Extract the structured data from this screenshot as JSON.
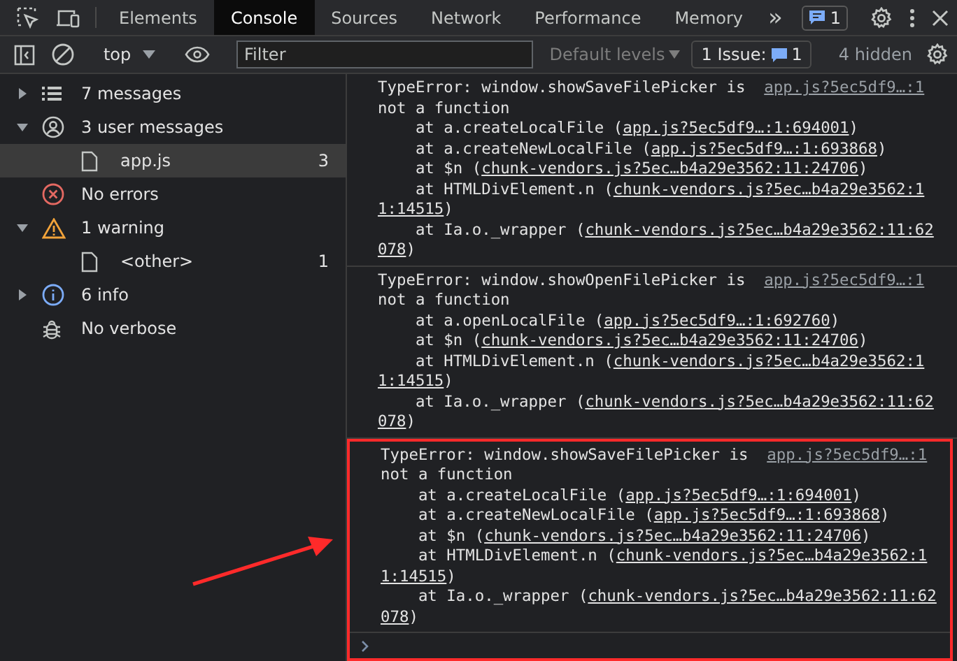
{
  "main_tabs": [
    {
      "label": "Elements",
      "selected": false
    },
    {
      "label": "Console",
      "selected": true
    },
    {
      "label": "Sources",
      "selected": false
    },
    {
      "label": "Network",
      "selected": false
    },
    {
      "label": "Performance",
      "selected": false
    },
    {
      "label": "Memory",
      "selected": false
    }
  ],
  "more_tabs": "»",
  "messages_badge": "1",
  "toolbar": {
    "context": "top",
    "filter": {
      "placeholder": "Filter"
    },
    "levels": "Default levels",
    "issues_label": "1 Issue:",
    "issues_count": "1",
    "hidden": "4 hidden"
  },
  "sidebar": {
    "items": [
      {
        "label": "7 messages",
        "kind": "list",
        "expanded": false,
        "selected": false
      },
      {
        "label": "3 user messages",
        "kind": "user",
        "expanded": true,
        "selected": false,
        "children": [
          {
            "label": "app.js",
            "kind": "file",
            "count": "3",
            "selected": true
          }
        ]
      },
      {
        "label": "No errors",
        "kind": "error",
        "selected": false
      },
      {
        "label": "1 warning",
        "kind": "warning",
        "expanded": true,
        "selected": false,
        "children": [
          {
            "label": "<other>",
            "kind": "file",
            "count": "1",
            "selected": false
          }
        ]
      },
      {
        "label": "6 info",
        "kind": "info",
        "expanded": false,
        "selected": false
      },
      {
        "label": "No verbose",
        "kind": "verbose",
        "selected": false
      }
    ]
  },
  "messages": [
    {
      "text": "TypeError: window.showSaveFilePicker is not a function",
      "source": "app.js?5ec5df9…:1",
      "highlighted": false,
      "stack": [
        {
          "prefix": "at a.createLocalFile (",
          "link": [
            "app.js?5ec5df9…:1:694001"
          ],
          "suffix": ")"
        },
        {
          "prefix": "at a.createNewLocalFile (",
          "link": [
            "app.js?5ec5df9…:1:693868"
          ],
          "suffix": ")"
        },
        {
          "prefix": "at $n (",
          "link": [
            "chunk-vendors.js?5ec…b4a29e3562:11:24706"
          ],
          "suffix": ")"
        },
        {
          "prefix": "at HTMLDivElement.n (",
          "link": [
            "chunk-vendors.js?5ec…b4a29e3562:1",
            "1:14515"
          ],
          "suffix": ")"
        },
        {
          "prefix": "at Ia.o._wrapper (",
          "link": [
            "chunk-vendors.js?5ec…b4a29e3562:11:62",
            "078"
          ],
          "suffix": ")"
        }
      ]
    },
    {
      "text": "TypeError: window.showOpenFilePicker is not a function",
      "source": "app.js?5ec5df9…:1",
      "highlighted": false,
      "stack": [
        {
          "prefix": "at a.openLocalFile (",
          "link": [
            "app.js?5ec5df9…:1:692760"
          ],
          "suffix": ")"
        },
        {
          "prefix": "at $n (",
          "link": [
            "chunk-vendors.js?5ec…b4a29e3562:11:24706"
          ],
          "suffix": ")"
        },
        {
          "prefix": "at HTMLDivElement.n (",
          "link": [
            "chunk-vendors.js?5ec…b4a29e3562:1",
            "1:14515"
          ],
          "suffix": ")"
        },
        {
          "prefix": "at Ia.o._wrapper (",
          "link": [
            "chunk-vendors.js?5ec…b4a29e3562:11:62",
            "078"
          ],
          "suffix": ")"
        }
      ]
    },
    {
      "text": "TypeError: window.showSaveFilePicker is not a function",
      "source": "app.js?5ec5df9…:1",
      "highlighted": true,
      "stack": [
        {
          "prefix": "at a.createLocalFile (",
          "link": [
            "app.js?5ec5df9…:1:694001"
          ],
          "suffix": ")"
        },
        {
          "prefix": "at a.createNewLocalFile (",
          "link": [
            "app.js?5ec5df9…:1:693868"
          ],
          "suffix": ")"
        },
        {
          "prefix": "at $n (",
          "link": [
            "chunk-vendors.js?5ec…b4a29e3562:11:24706"
          ],
          "suffix": ")"
        },
        {
          "prefix": "at HTMLDivElement.n (",
          "link": [
            "chunk-vendors.js?5ec…b4a29e3562:1",
            "1:14515"
          ],
          "suffix": ")"
        },
        {
          "prefix": "at Ia.o._wrapper (",
          "link": [
            "chunk-vendors.js?5ec…b4a29e3562:11:62",
            "078"
          ],
          "suffix": ")"
        }
      ]
    }
  ],
  "annotation_arrow": true
}
